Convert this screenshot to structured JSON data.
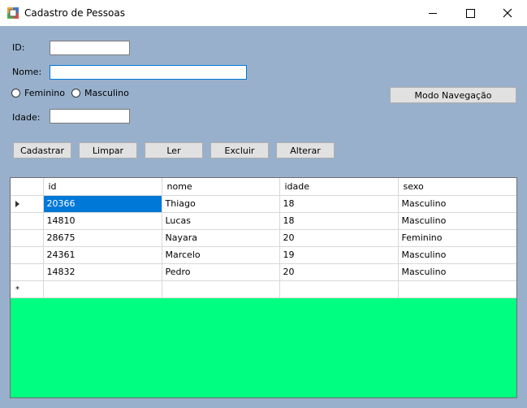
{
  "window": {
    "title": "Cadastro de Pessoas"
  },
  "form": {
    "id_label": "ID:",
    "id_value": "",
    "nome_label": "Nome:",
    "nome_value": "",
    "feminino_label": "Feminino",
    "feminino_checked": false,
    "masculino_label": "Masculino",
    "masculino_checked": false,
    "idade_label": "Idade:",
    "idade_value": "",
    "modo_navegacao_label": "Modo Navegação"
  },
  "buttons": {
    "cadastrar": "Cadastrar",
    "limpar": "Limpar",
    "ler": "Ler",
    "excluir": "Excluir",
    "alterar": "Alterar"
  },
  "grid": {
    "columns": [
      "id",
      "nome",
      "idade",
      "sexo"
    ],
    "rows": [
      {
        "id": "20366",
        "nome": "Thiago",
        "idade": "18",
        "sexo": "Masculino"
      },
      {
        "id": "14810",
        "nome": "Lucas",
        "idade": "18",
        "sexo": "Masculino"
      },
      {
        "id": "28675",
        "nome": "Nayara",
        "idade": "20",
        "sexo": "Feminino"
      },
      {
        "id": "24361",
        "nome": "Marcelo",
        "idade": "19",
        "sexo": "Masculino"
      },
      {
        "id": "14832",
        "nome": "Pedro",
        "idade": "20",
        "sexo": "Masculino"
      }
    ],
    "new_row_marker": "*"
  },
  "colors": {
    "client_background": "#98b0cc",
    "grid_background": "#00ff80",
    "selection": "#0078d7"
  }
}
